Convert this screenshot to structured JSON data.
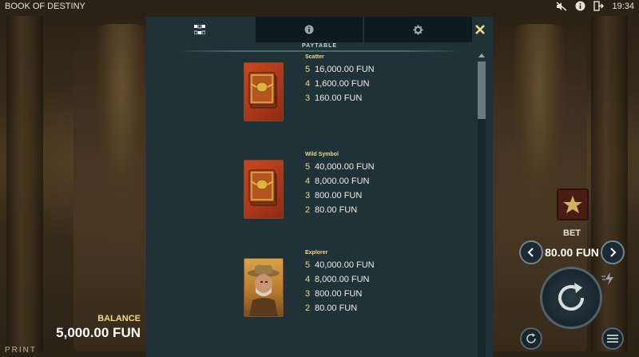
{
  "game": {
    "title": "BOOK OF DESTINY",
    "brand": "PRINT"
  },
  "topbar": {
    "clock": "19:34",
    "icons": [
      "sound-off-icon",
      "info-icon",
      "exit-icon"
    ]
  },
  "balance": {
    "label": "BALANCE",
    "value": "5,000.00 FUN"
  },
  "bet": {
    "label": "BET",
    "value": "80.00 FUN"
  },
  "paytable": {
    "tabs": [
      {
        "icon": "paytable-icon",
        "active": true
      },
      {
        "icon": "info-icon",
        "active": false
      },
      {
        "icon": "gear-icon",
        "active": false
      }
    ],
    "section_title": "PAYTABLE",
    "symbols": [
      {
        "name": "Scatter",
        "icon": "book-icon",
        "pays": [
          {
            "count": "5",
            "amount": "16,000.00 FUN"
          },
          {
            "count": "4",
            "amount": "1,600.00 FUN"
          },
          {
            "count": "3",
            "amount": "160.00 FUN"
          }
        ]
      },
      {
        "name": "Wild Symbol",
        "icon": "book-icon",
        "pays": [
          {
            "count": "5",
            "amount": "40,000.00 FUN"
          },
          {
            "count": "4",
            "amount": "8,000.00 FUN"
          },
          {
            "count": "3",
            "amount": "800.00 FUN"
          },
          {
            "count": "2",
            "amount": "80.00 FUN"
          }
        ]
      },
      {
        "name": "Explorer",
        "icon": "explorer-icon",
        "pays": [
          {
            "count": "5",
            "amount": "40,000.00 FUN"
          },
          {
            "count": "4",
            "amount": "8,000.00 FUN"
          },
          {
            "count": "3",
            "amount": "800.00 FUN"
          },
          {
            "count": "2",
            "amount": "80.00 FUN"
          }
        ]
      }
    ]
  },
  "colors": {
    "accent_gold": "#f2d888",
    "panel_bg": "#1f3238",
    "tab_inactive": "#0d1a1f"
  }
}
